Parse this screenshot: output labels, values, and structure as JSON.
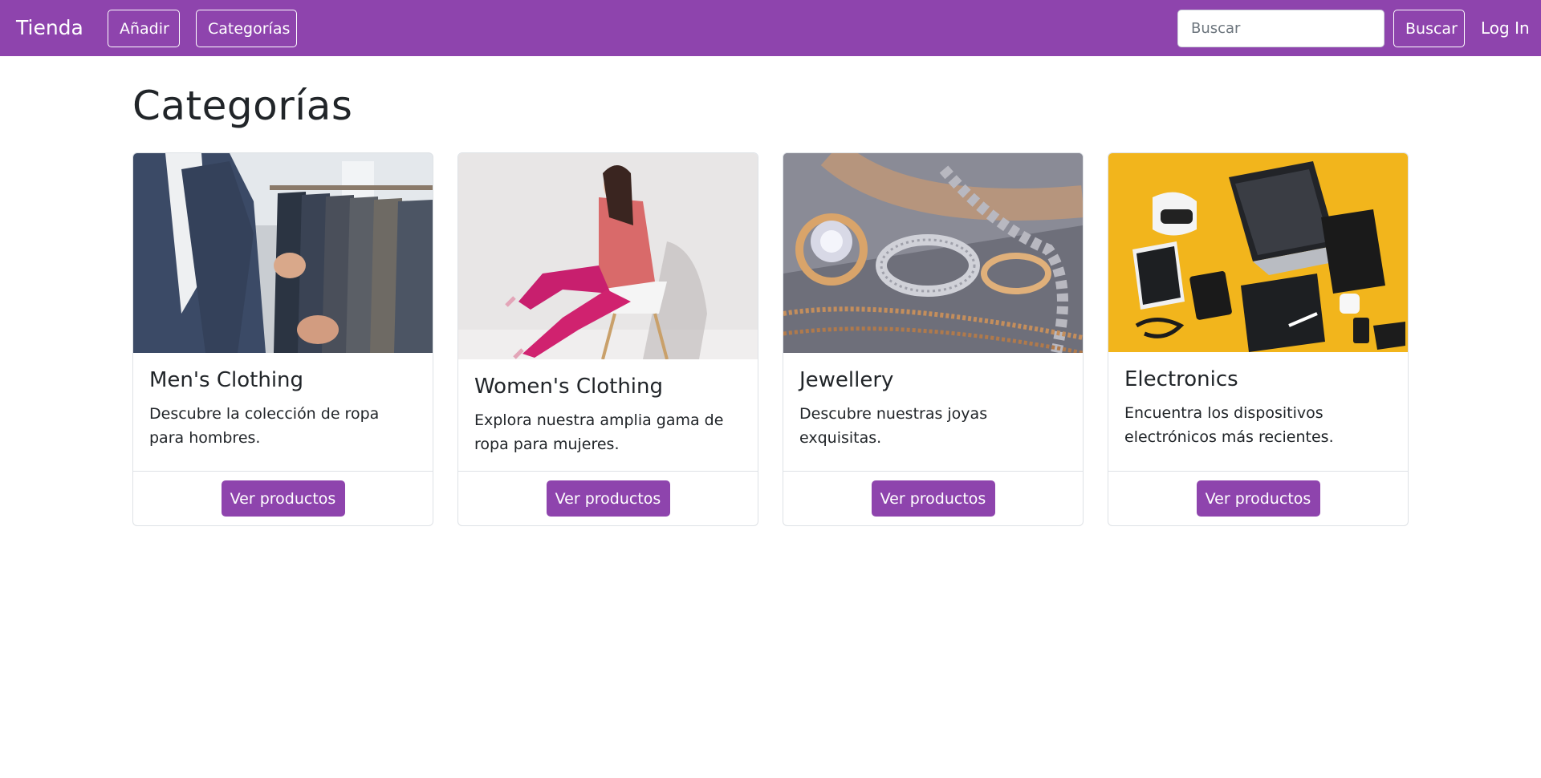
{
  "navbar": {
    "brand": "Tienda",
    "add_label": "Añadir",
    "categories_label": "Categorías",
    "search_placeholder": "Buscar",
    "search_value": "",
    "search_button": "Buscar",
    "login_label": "Log In",
    "color": "#8e44ad"
  },
  "main": {
    "title": "Categorías",
    "categories": [
      {
        "title": "Men's Clothing",
        "description": "Descubre la colección de ropa para hombres.",
        "button": "Ver productos",
        "image": "mens-clothing-image"
      },
      {
        "title": "Women's Clothing",
        "description": "Explora nuestra amplia gama de ropa para mujeres.",
        "button": "Ver productos",
        "image": "womens-clothing-image"
      },
      {
        "title": "Jewellery",
        "description": "Descubre nuestras joyas exquisitas.",
        "button": "Ver productos",
        "image": "jewellery-image"
      },
      {
        "title": "Electronics",
        "description": "Encuentra los dispositivos electrónicos más recientes.",
        "button": "Ver productos",
        "image": "electronics-image"
      }
    ]
  }
}
